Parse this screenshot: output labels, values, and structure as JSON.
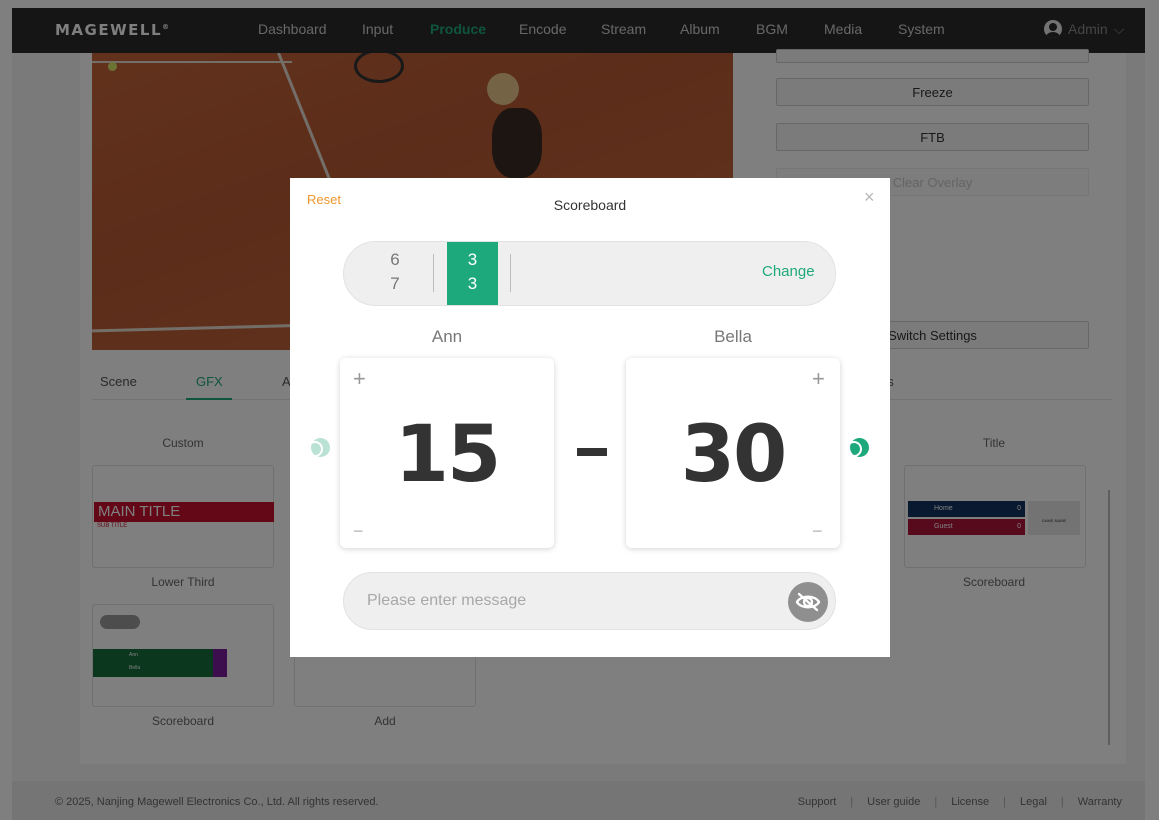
{
  "navbar": {
    "logo": "MAGEWELL",
    "logo_mark": "®",
    "items": [
      "Dashboard",
      "Input",
      "Produce",
      "Encode",
      "Stream",
      "Album",
      "BGM",
      "Media",
      "System"
    ],
    "active": "Produce",
    "user": "Admin",
    "user_caret": "⌵"
  },
  "side_buttons": {
    "freeze": "Freeze",
    "ftb": "FTB",
    "clear_overlay": "Clear Overlay",
    "switch_settings": "Switch Settings"
  },
  "tabs": [
    "Scene",
    "GFX",
    "A",
    "Its"
  ],
  "gfx": {
    "categories": {
      "custom": "Custom",
      "title": "Title"
    },
    "tiles": {
      "lower_third": "Lower Third",
      "scoreboard_left": "Scoreboard",
      "add": "Add",
      "scoreboard_right": "Scoreboard"
    },
    "lower_third_preview": {
      "main": "MAIN TITLE",
      "sub": "SUB TITLE"
    },
    "scoreboard_preview": {
      "home": "Home",
      "guest": "Guest",
      "home_score": "0",
      "guest_score": "0",
      "side_text": "GAME NAME",
      "green_p1": "Ann",
      "green_p2": "Bella"
    }
  },
  "footer": {
    "copyright": "© 2025, Nanjing Magewell Electronics Co., Ltd. All rights reserved.",
    "links": [
      "Support",
      "User guide",
      "License",
      "Legal",
      "Warranty"
    ]
  },
  "modal": {
    "title": "Scoreboard",
    "reset_label": "Reset",
    "close": "×",
    "sets": {
      "previous": {
        "p1": "6",
        "p2": "7"
      },
      "current": {
        "p1": "3",
        "p2": "3"
      }
    },
    "change_label": "Change",
    "player1": {
      "name": "Ann",
      "score": "15"
    },
    "player2": {
      "name": "Bella",
      "score": "30"
    },
    "serving": "Bella",
    "plus": "+",
    "minus": "−",
    "message_placeholder": "Please enter message"
  },
  "colors": {
    "accent": "#1ea97c",
    "reset": "#f0962c",
    "nav_bg": "#2b2b2b",
    "lower_third": "#c8102e"
  }
}
